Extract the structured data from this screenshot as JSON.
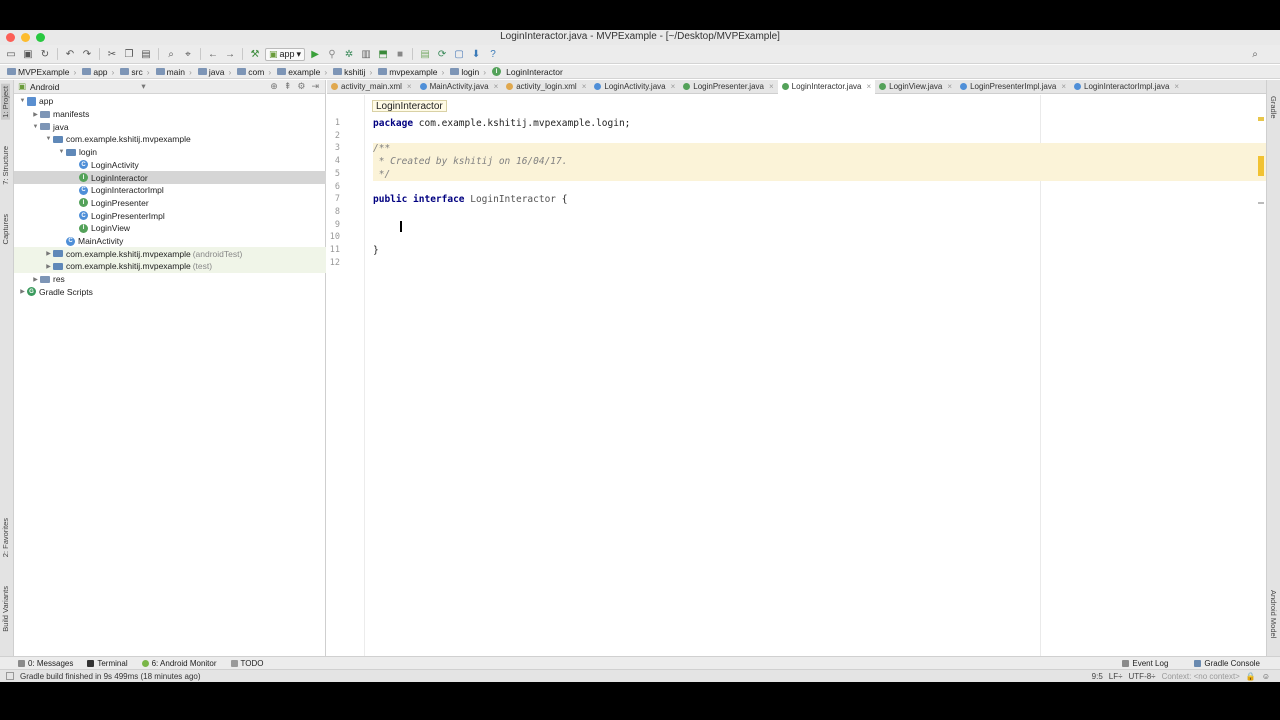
{
  "window": {
    "title": "LoginInteractor.java - MVPExample - [~/Desktop/MVPExample]",
    "lights": [
      "#fc5f57",
      "#fdbc2e",
      "#28c840"
    ]
  },
  "toolbar": {
    "run_config": "app"
  },
  "breadcrumbs": [
    "MVPExample",
    "app",
    "src",
    "main",
    "java",
    "com",
    "example",
    "kshitij",
    "mvpexample",
    "login",
    "LoginInteractor"
  ],
  "left_tools": {
    "project": "1: Project",
    "structure": "7: Structure",
    "captures": "Captures",
    "favorites": "2: Favorites",
    "build_variants": "Build Variants"
  },
  "right_tools": {
    "gradle": "Gradle",
    "android_model": "Android Model"
  },
  "project_panel": {
    "view_mode": "Android",
    "tree": [
      {
        "label": "app",
        "depth": 0,
        "icon": "module",
        "expanded": true
      },
      {
        "label": "manifests",
        "depth": 1,
        "icon": "folder",
        "expanded": false
      },
      {
        "label": "java",
        "depth": 1,
        "icon": "folder",
        "expanded": true
      },
      {
        "label": "com.example.kshitij.mvpexample",
        "depth": 2,
        "icon": "package",
        "expanded": true
      },
      {
        "label": "login",
        "depth": 3,
        "icon": "package",
        "expanded": true
      },
      {
        "label": "LoginActivity",
        "depth": 4,
        "icon": "class"
      },
      {
        "label": "LoginInteractor",
        "depth": 4,
        "icon": "interface",
        "selected": true
      },
      {
        "label": "LoginInteractorImpl",
        "depth": 4,
        "icon": "class"
      },
      {
        "label": "LoginPresenter",
        "depth": 4,
        "icon": "interface"
      },
      {
        "label": "LoginPresenterImpl",
        "depth": 4,
        "icon": "class"
      },
      {
        "label": "LoginView",
        "depth": 4,
        "icon": "interface"
      },
      {
        "label": "MainActivity",
        "depth": 3,
        "icon": "class"
      },
      {
        "label": "com.example.kshitij.mvpexample",
        "suffix": "(androidTest)",
        "depth": 2,
        "icon": "package",
        "expanded": false,
        "test": true
      },
      {
        "label": "com.example.kshitij.mvpexample",
        "suffix": "(test)",
        "depth": 2,
        "icon": "package",
        "expanded": false,
        "test": true
      },
      {
        "label": "res",
        "depth": 1,
        "icon": "folder",
        "expanded": false
      },
      {
        "label": "Gradle Scripts",
        "depth": 0,
        "icon": "gradle",
        "expanded": false
      }
    ]
  },
  "editor": {
    "tabs": [
      {
        "label": "activity_main.xml",
        "color": "#e0a84e"
      },
      {
        "label": "MainActivity.java",
        "color": "#4f8fd8"
      },
      {
        "label": "activity_login.xml",
        "color": "#e0a84e"
      },
      {
        "label": "LoginActivity.java",
        "color": "#4f8fd8"
      },
      {
        "label": "LoginPresenter.java",
        "color": "#54a25a"
      },
      {
        "label": "LoginInteractor.java",
        "color": "#54a25a",
        "active": true
      },
      {
        "label": "LoginView.java",
        "color": "#54a25a"
      },
      {
        "label": "LoginPresenterImpl.java",
        "color": "#4f8fd8"
      },
      {
        "label": "LoginInteractorImpl.java",
        "color": "#4f8fd8"
      }
    ],
    "hint": "LoginInteractor",
    "line_numbers": [
      "1",
      "2",
      "3",
      "4",
      "5",
      "6",
      "7",
      "8",
      "9",
      "10",
      "11",
      "12"
    ],
    "cursor_line": 9,
    "lines": [
      {
        "kw": "package",
        "text": " com.example.kshitij.mvpexample.login;"
      },
      {
        "text": ""
      },
      {
        "cm": "/**",
        "doc": true
      },
      {
        "cm": " * Created by kshitij on 16/04/17.",
        "doc": true
      },
      {
        "cm": " */",
        "doc": true
      },
      {
        "text": ""
      },
      {
        "kw": "public interface",
        "iface": " LoginInteractor",
        "text": " {"
      },
      {
        "text": ""
      },
      {
        "text": "    "
      },
      {
        "text": ""
      },
      {
        "text": "}"
      },
      {
        "text": ""
      }
    ]
  },
  "bottom_tools": {
    "left": [
      "0: Messages",
      "Terminal",
      "6: Android Monitor",
      "TODO"
    ],
    "right": [
      "Event Log",
      "Gradle Console"
    ]
  },
  "status": {
    "message": "Gradle build finished in 9s 499ms (18 minutes ago)",
    "position": "9:5",
    "line_sep": "LF÷",
    "encoding": "UTF-8÷",
    "context": "Context: <no context>"
  }
}
